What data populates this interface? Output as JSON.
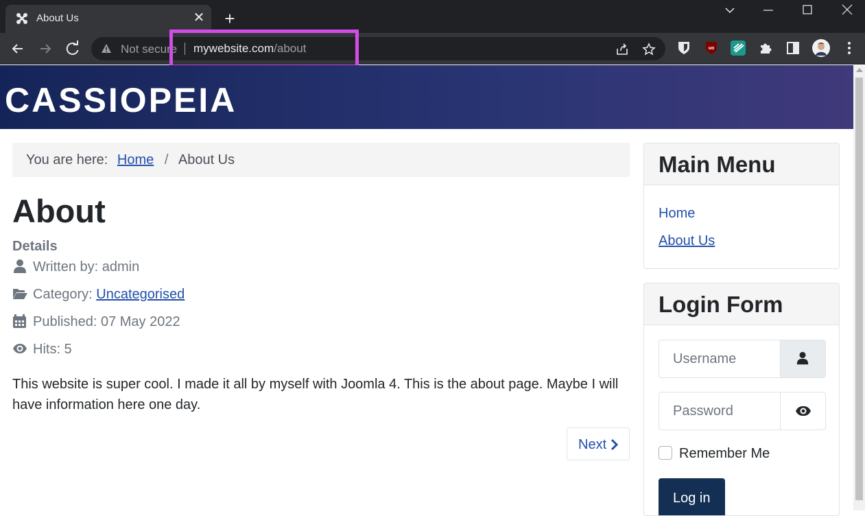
{
  "browser": {
    "tab_title": "About Us",
    "new_tab_symbol": "+",
    "close_symbol": "✕",
    "security_label": "Not secure",
    "url_host": "mywebsite.com",
    "url_path": "/about"
  },
  "site": {
    "brand": "CASSIOPEIA",
    "banner_colors": [
      "#152458",
      "#40397a"
    ]
  },
  "breadcrumb": {
    "prefix": "You are here:",
    "home": "Home",
    "separator": "/",
    "current": "About Us"
  },
  "article": {
    "title": "About",
    "details_heading": "Details",
    "written_by": "Written by: admin",
    "category_label": "Category:",
    "category_value": "Uncategorised",
    "published": "Published: 07 May 2022",
    "hits": "Hits: 5",
    "body": "This website is super cool. I made it all by myself with Joomla 4. This is the about page. Maybe I will have information here one day.",
    "next_label": "Next"
  },
  "main_menu": {
    "title": "Main Menu",
    "items": [
      "Home",
      "About Us"
    ]
  },
  "login_form": {
    "title": "Login Form",
    "username_placeholder": "Username",
    "password_placeholder": "Password",
    "remember_label": "Remember Me",
    "login_label": "Log in"
  },
  "colors": {
    "link": "#224faa",
    "highlight": "#d24de6",
    "login_button": "#132f53"
  },
  "icons": [
    "joomla-favicon",
    "warning-icon",
    "share-icon",
    "star-icon",
    "bitwarden-icon",
    "ublock-icon",
    "extension-icon",
    "puzzle-icon",
    "sidepanel-icon",
    "avatar",
    "menu-icon",
    "user-icon",
    "folder-icon",
    "calendar-icon",
    "eye-icon",
    "chevron-right-icon"
  ]
}
